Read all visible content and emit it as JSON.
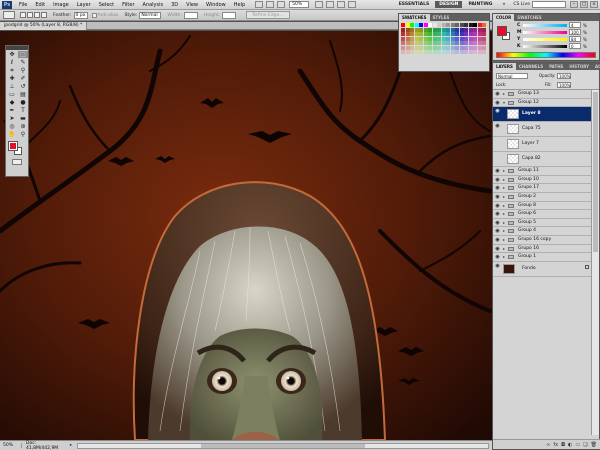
{
  "app": {
    "logo": "Ps"
  },
  "menu": [
    "File",
    "Edit",
    "Image",
    "Layer",
    "Select",
    "Filter",
    "Analysis",
    "3D",
    "View",
    "Window",
    "Help"
  ],
  "zoom_box": "50%",
  "workspace": {
    "buttons": [
      {
        "label": "ESSENTIALS",
        "active": false
      },
      {
        "label": "DESIGN",
        "active": true
      },
      {
        "label": "PAINTING",
        "active": false
      }
    ],
    "more": "»",
    "cs_live": "CS Live"
  },
  "options": {
    "feather_label": "Feather:",
    "feather_value": "0 px",
    "antialias_label": "Anti-alias",
    "style_label": "Style:",
    "style_value": "Normal",
    "width_label": "Width:",
    "height_label": "Height:",
    "refine_label": "Refine Edge..."
  },
  "document": {
    "tab_title": "jpodgrid @ 50% (Layer 8, RGB/8) *",
    "zoom": "50%",
    "doc_size": "Doc: 41,8M/442,9M"
  },
  "swatches_panel": {
    "tabs": [
      {
        "label": "SWATCHES",
        "active": true
      },
      {
        "label": "STYLES",
        "active": false
      }
    ]
  },
  "color_panel": {
    "tabs": [
      {
        "label": "COLOR",
        "active": true
      },
      {
        "label": "SWATCHES",
        "active": false
      }
    ],
    "fg_color": "#e4102b",
    "channels": [
      {
        "label": "C",
        "value": "4"
      },
      {
        "label": "M",
        "value": "100"
      },
      {
        "label": "Y",
        "value": "84"
      },
      {
        "label": "K",
        "value": "0"
      }
    ]
  },
  "layers_panel": {
    "tabs": [
      {
        "label": "LAYERS",
        "active": true
      },
      {
        "label": "CHANNELS",
        "active": false
      },
      {
        "label": "PATHS",
        "active": false
      },
      {
        "label": "HISTORY",
        "active": false
      },
      {
        "label": "ACTIONS",
        "active": false
      }
    ],
    "blend_mode": "Normal",
    "opacity_label": "Opacity:",
    "opacity_value": "100%",
    "lock_label": "Lock:",
    "fill_label": "Fill:",
    "fill_value": "100%",
    "layers": [
      {
        "name": "Group 13",
        "type": "group",
        "visible": true,
        "selected": false
      },
      {
        "name": "Group 12",
        "type": "group",
        "visible": true,
        "selected": false,
        "expanded": true
      },
      {
        "name": "Layer 8",
        "type": "layer",
        "visible": true,
        "selected": true
      },
      {
        "name": "Capa 75",
        "type": "layer",
        "visible": true,
        "selected": false
      },
      {
        "name": "Layer 7",
        "type": "layer",
        "visible": false,
        "selected": false
      },
      {
        "name": "Capa 82",
        "type": "layer",
        "visible": false,
        "selected": false
      },
      {
        "name": "Group 11",
        "type": "group",
        "visible": true,
        "selected": false
      },
      {
        "name": "Group 10",
        "type": "group",
        "visible": true,
        "selected": false
      },
      {
        "name": "Grupo 17",
        "type": "group",
        "visible": true,
        "selected": false
      },
      {
        "name": "Group 2",
        "type": "group",
        "visible": true,
        "selected": false
      },
      {
        "name": "Group 8",
        "type": "group",
        "visible": true,
        "selected": false
      },
      {
        "name": "Group 6",
        "type": "group",
        "visible": true,
        "selected": false
      },
      {
        "name": "Group 5",
        "type": "group",
        "visible": true,
        "selected": false
      },
      {
        "name": "Group 4",
        "type": "group",
        "visible": true,
        "selected": false
      },
      {
        "name": "Grupo 16 copy",
        "type": "group",
        "visible": true,
        "selected": false
      },
      {
        "name": "Grupo 16",
        "type": "group",
        "visible": true,
        "selected": false
      },
      {
        "name": "Group 1",
        "type": "group",
        "visible": true,
        "selected": false
      },
      {
        "name": "Fondo",
        "type": "background",
        "visible": true,
        "selected": false
      }
    ]
  }
}
